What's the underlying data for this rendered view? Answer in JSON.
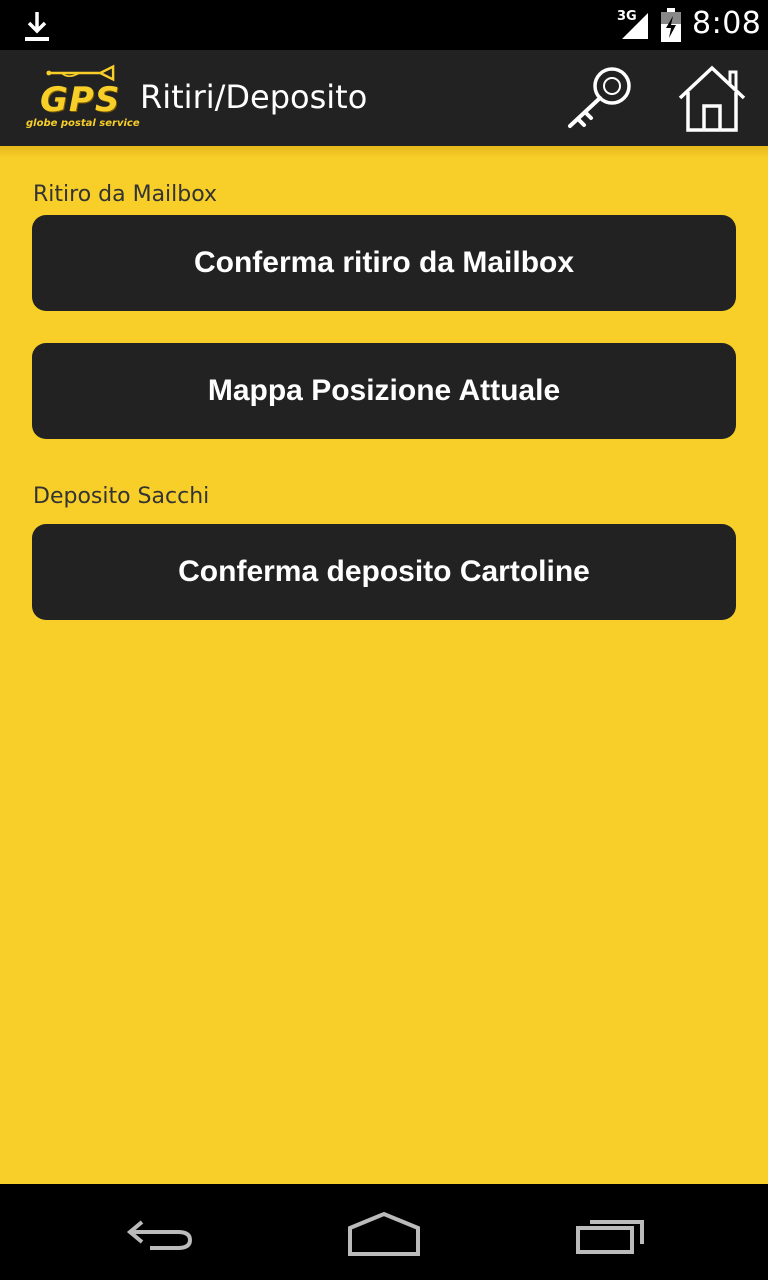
{
  "status_bar": {
    "time": "8:08",
    "network": "3G",
    "icons": [
      "download-icon",
      "signal-icon",
      "battery-icon"
    ]
  },
  "action_bar": {
    "logo_text": "GPS",
    "logo_subtitle": "globe postal service",
    "title": "Ritiri/Deposito",
    "icons": [
      "key-icon",
      "home-icon"
    ]
  },
  "sections": {
    "mailbox": {
      "label": "Ritiro da Mailbox",
      "confirm_button": "Conferma ritiro da Mailbox",
      "map_button": "Mappa Posizione Attuale"
    },
    "deposit": {
      "label": "Deposito Sacchi",
      "confirm_button": "Conferma deposito Cartoline"
    }
  },
  "nav_bar": {
    "icons": [
      "back-icon",
      "home-nav-icon",
      "recent-apps-icon"
    ]
  },
  "colors": {
    "background": "#F8CF28",
    "bar": "#222222",
    "button": "#222222",
    "button_text": "#FFFFFF",
    "label_text": "#333333"
  }
}
